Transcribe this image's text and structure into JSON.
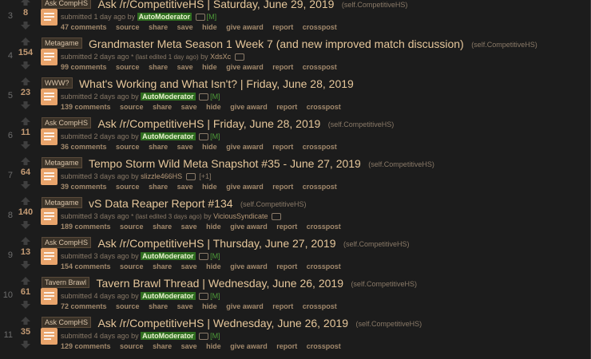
{
  "posts": [
    {
      "rank": "3",
      "score": "8",
      "flair": "Ask CompHS",
      "title": "Ask /r/CompetitiveHS | Saturday, June 29, 2019",
      "domain": "(self.CompetitiveHS)",
      "time": "1 day ago",
      "edited": "",
      "author": "AutoModerator",
      "automod": true,
      "mod": "[M]",
      "extra": "",
      "comments": "47 comments"
    },
    {
      "rank": "4",
      "score": "154",
      "flair": "Metagame",
      "title": "Grandmaster Meta Season 1 Week 7 (and new improved match discussion)",
      "domain": "(self.CompetitiveHS)",
      "time": "2 days ago",
      "edited": "* (last edited 1 day ago)",
      "author": "XdsXc",
      "automod": false,
      "mod": "",
      "extra": "",
      "comments": "99 comments"
    },
    {
      "rank": "5",
      "score": "23",
      "flair": "WWW?",
      "title": "What's Working and What Isn't? | Friday, June 28, 2019",
      "domain": "",
      "time": "2 days ago",
      "edited": "",
      "author": "AutoModerator",
      "automod": true,
      "mod": "[M]",
      "extra": "",
      "comments": "139 comments"
    },
    {
      "rank": "6",
      "score": "11",
      "flair": "Ask CompHS",
      "title": "Ask /r/CompetitiveHS | Friday, June 28, 2019",
      "domain": "(self.CompetitiveHS)",
      "time": "2 days ago",
      "edited": "",
      "author": "AutoModerator",
      "automod": true,
      "mod": "[M]",
      "extra": "",
      "comments": "36 comments"
    },
    {
      "rank": "7",
      "score": "64",
      "flair": "Metagame",
      "title": "Tempo Storm Wild Meta Snapshot #35 - June 27, 2019",
      "domain": "(self.CompetitiveHS)",
      "time": "3 days ago",
      "edited": "",
      "author": "slizzle466HS",
      "automod": false,
      "mod": "",
      "extra": "[+1]",
      "comments": "39 comments"
    },
    {
      "rank": "8",
      "score": "140",
      "flair": "Metagame",
      "title": "vS Data Reaper Report #134",
      "domain": "(self.CompetitiveHS)",
      "time": "3 days ago",
      "edited": "* (last edited 3 days ago)",
      "author": "ViciousSyndicate",
      "automod": false,
      "mod": "",
      "extra": "",
      "comments": "189 comments"
    },
    {
      "rank": "9",
      "score": "13",
      "flair": "Ask CompHS",
      "title": "Ask /r/CompetitiveHS | Thursday, June 27, 2019",
      "domain": "(self.CompetitiveHS)",
      "time": "3 days ago",
      "edited": "",
      "author": "AutoModerator",
      "automod": true,
      "mod": "[M]",
      "extra": "",
      "comments": "154 comments"
    },
    {
      "rank": "10",
      "score": "61",
      "flair": "Tavern Brawl",
      "title": "Tavern Brawl Thread | Wednesday, June 26, 2019",
      "domain": "(self.CompetitiveHS)",
      "time": "4 days ago",
      "edited": "",
      "author": "AutoModerator",
      "automod": true,
      "mod": "[M]",
      "extra": "",
      "comments": "72 comments"
    },
    {
      "rank": "11",
      "score": "35",
      "flair": "Ask CompHS",
      "title": "Ask /r/CompetitiveHS | Wednesday, June 26, 2019",
      "domain": "(self.CompetitiveHS)",
      "time": "4 days ago",
      "edited": "",
      "author": "AutoModerator",
      "automod": true,
      "mod": "[M]",
      "extra": "",
      "comments": "129 comments"
    }
  ],
  "labels": {
    "submitted": "submitted",
    "by": "by",
    "source": "source",
    "share": "share",
    "save": "save",
    "hide": "hide",
    "give_award": "give award",
    "report": "report",
    "crosspost": "crosspost"
  },
  "icons": {
    "upvote": "upvote-arrow-icon",
    "downvote": "downvote-arrow-icon",
    "thumbnail": "self-post-icon",
    "message": "message-icon"
  },
  "colors": {
    "background": "#1c1c1c",
    "title": "#e6c79b",
    "automod_bg": "#2f6e20",
    "thumbnail": "#e9a46b"
  }
}
